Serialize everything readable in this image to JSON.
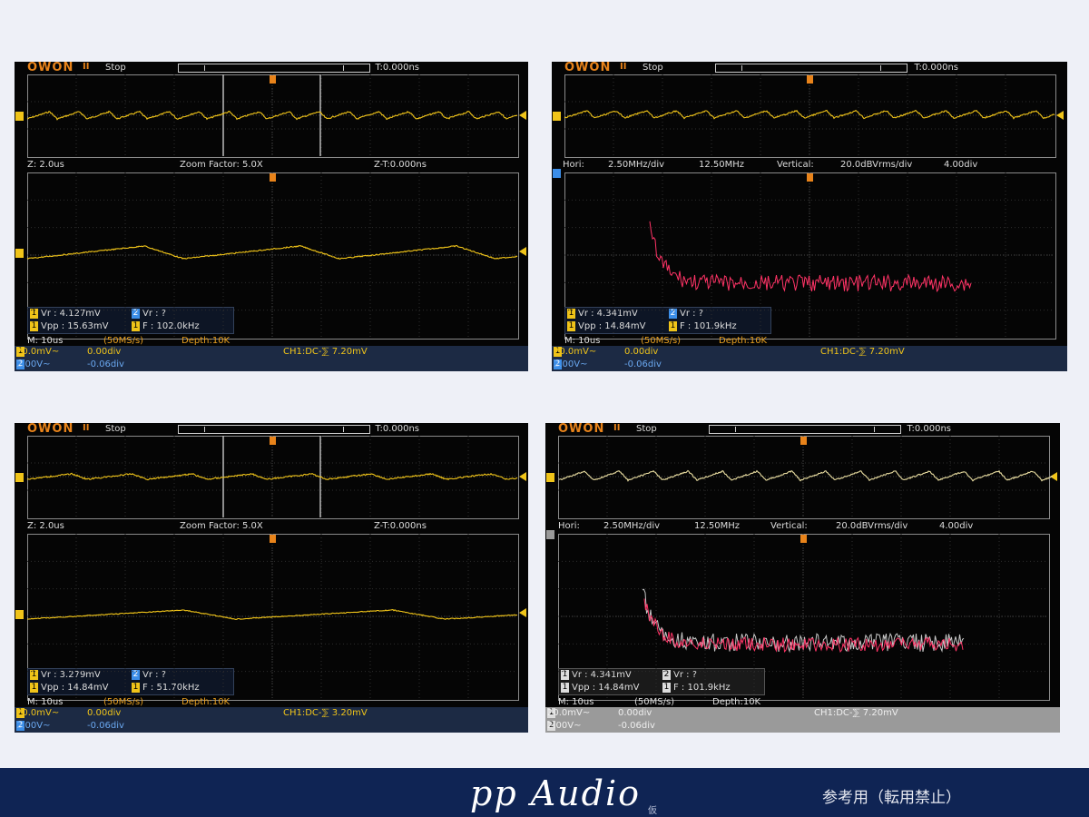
{
  "scopes": [
    {
      "logo": "OWON",
      "run_icon": "II",
      "status": "Stop",
      "trigger_time": "T:0.000ns",
      "zoom_row": {
        "z": "Z: 2.0us",
        "factor": "Zoom Factor: 5.0X",
        "zt": "Z-T:0.000ns"
      },
      "meas": {
        "m1": "Vr : 4.127mV",
        "m2": "Vr :     ?",
        "m3": "Vpp : 15.63mV",
        "m4": "F : 102.0kHz"
      },
      "timebase": "M: 10us",
      "sample": "(50MS/s)",
      "depth": "Depth:10K",
      "ch1": {
        "volts": "20.0mV~",
        "offset": "0.00div"
      },
      "ch2": {
        "volts": "2.00V~",
        "offset": "-0.06div"
      },
      "trigger": "CH1:DC-⅀ 7.20mV"
    },
    {
      "logo": "OWON",
      "run_icon": "II",
      "status": "Stop",
      "trigger_time": "T:0.000ns",
      "fft_row": {
        "hori": "Hori:",
        "hori_val": "2.50MHz/div",
        "center": "12.50MHz",
        "vert": "Vertical:",
        "vert_val": "20.0dBVrms/div",
        "offset": "4.00div"
      },
      "meas": {
        "m1": "Vr : 4.341mV",
        "m2": "Vr :     ?",
        "m3": "Vpp : 14.84mV",
        "m4": "F : 101.9kHz"
      },
      "timebase": "M: 10us",
      "sample": "(50MS/s)",
      "depth": "Depth:10K",
      "ch1": {
        "volts": "20.0mV~",
        "offset": "0.00div"
      },
      "ch2": {
        "volts": "2.00V~",
        "offset": "-0.06div"
      },
      "trigger": "CH1:DC-⅀ 7.20mV"
    },
    {
      "logo": "OWON",
      "run_icon": "II",
      "status": "Stop",
      "trigger_time": "T:0.000ns",
      "zoom_row": {
        "z": "Z: 2.0us",
        "factor": "Zoom Factor: 5.0X",
        "zt": "Z-T:0.000ns"
      },
      "meas": {
        "m1": "Vr : 3.279mV",
        "m2": "Vr :     ?",
        "m3": "Vpp : 14.84mV",
        "m4": "F : 51.70kHz"
      },
      "timebase": "M: 10us",
      "sample": "(50MS/s)",
      "depth": "Depth:10K",
      "ch1": {
        "volts": "20.0mV~",
        "offset": "0.00div"
      },
      "ch2": {
        "volts": "2.00V~",
        "offset": "-0.06div"
      },
      "trigger": "CH1:DC-⅀ 3.20mV"
    },
    {
      "logo": "OWON",
      "run_icon": "II",
      "status": "Stop",
      "trigger_time": "T:0.000ns",
      "fft_row": {
        "hori": "Hori:",
        "hori_val": "2.50MHz/div",
        "center": "12.50MHz",
        "vert": "Vertical:",
        "vert_val": "20.0dBVrms/div",
        "offset": "4.00div"
      },
      "meas": {
        "m1": "Vr : 4.341mV",
        "m2": "Vr :     ?",
        "m3": "Vpp : 14.84mV",
        "m4": "F : 101.9kHz"
      },
      "timebase": "M: 10us",
      "sample": "(50MS/s)",
      "depth": "Depth:10K",
      "ch1": {
        "volts": "20.0mV~",
        "offset": "0.00div"
      },
      "ch2": {
        "volts": "2.00V~",
        "offset": "-0.06div"
      },
      "trigger": "CH1:DC-⅀ 7.20mV"
    }
  ],
  "channel_badges": {
    "one": "1",
    "two": "2",
    "math": "M",
    "trig": "T"
  },
  "colors": {
    "ch1": "#f0c419",
    "fft": "#ff3366",
    "fft_gray": "#c8c8c8",
    "footer": "#0f2454"
  },
  "footer": {
    "brand": "pp Audio",
    "brand_sub": "仮",
    "note": "参考用（転用禁止）"
  }
}
